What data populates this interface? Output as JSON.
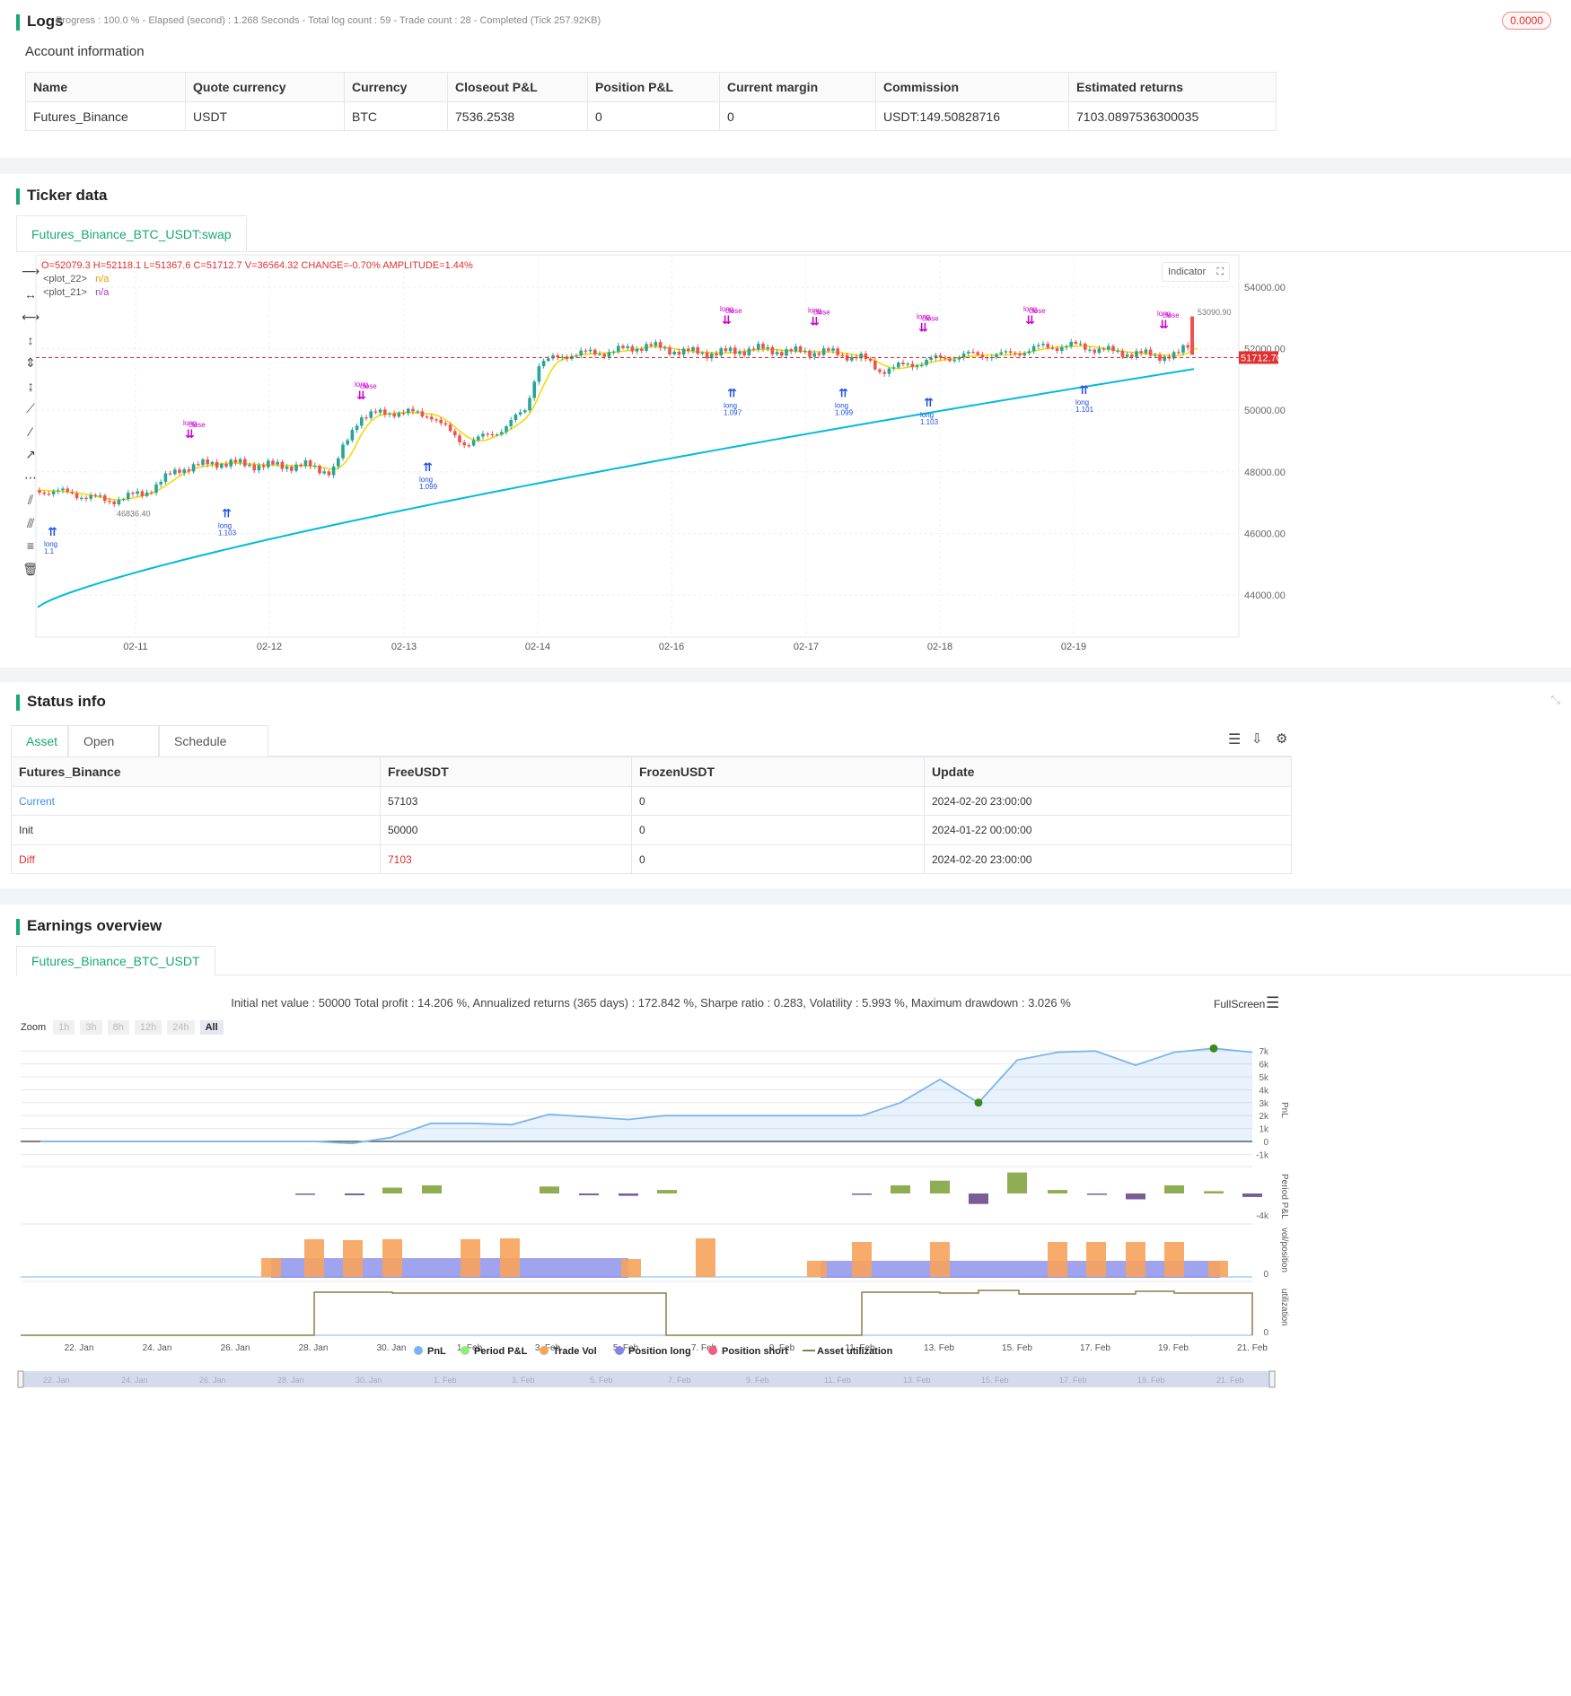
{
  "logs": {
    "title": "Logs",
    "summary": "Progress : 100.0 % - Elapsed (second) : 1.268  Seconds - Total log count : 59 - Trade count : 28 - Completed (Tick 257.92KB)",
    "badge": "0.0000"
  },
  "account": {
    "title": "Account information",
    "headers": [
      "Name",
      "Quote currency",
      "Currency",
      "Closeout P&L",
      "Position P&L",
      "Current margin",
      "Commission",
      "Estimated returns"
    ],
    "row": [
      "Futures_Binance",
      "USDT",
      "BTC",
      "7536.2538",
      "0",
      "0",
      "USDT:149.50828716",
      "7103.0897536300035"
    ]
  },
  "ticker": {
    "title": "Ticker data",
    "tab": "Futures_Binance_BTC_USDT:swap",
    "ohlc": "O=52079.3 H=52118.1 L=51367.6 C=51712.7 V=36564.32 CHANGE=-0.70% AMPLITUDE=1.44%",
    "plot22": "<plot_22>",
    "plot21": "<plot_21>",
    "na": "n/a",
    "indicator_btn": "Indicator",
    "last_price": "51712.70",
    "high_label": "53090.90",
    "low_label": "46836.40",
    "y_ticks": [
      "54000.00",
      "52000.00",
      "50000.00",
      "48000.00",
      "46000.00",
      "44000.00"
    ],
    "x_ticks": [
      "02-11",
      "02-12",
      "02-13",
      "02-14",
      "02-16",
      "02-17",
      "02-18",
      "02-19"
    ],
    "colors": {
      "up": "#26a69a",
      "down": "#ef5350",
      "ma_fast": "#f5d90a",
      "ma_slow": "#00bcd4",
      "signal": "#cc00cc",
      "long": "#1e50e6"
    },
    "markers": {
      "long": "long",
      "close": "close"
    },
    "trade_labels": [
      "1.1",
      "1.103",
      "1.099",
      "1.097",
      "1.099",
      "1.103",
      "1.101"
    ]
  },
  "status": {
    "title": "Status info",
    "tabs": [
      "Asset",
      "Open orders",
      "Schedule orders"
    ],
    "headers": [
      "Futures_Binance",
      "FreeUSDT",
      "FrozenUSDT",
      "Update"
    ],
    "rows": [
      [
        "Current",
        "57103",
        "0",
        "2024-02-20 23:00:00"
      ],
      [
        "Init",
        "50000",
        "0",
        "2024-01-22 00:00:00"
      ],
      [
        "Diff",
        "7103",
        "0",
        "2024-02-20 23:00:00"
      ]
    ]
  },
  "earnings": {
    "title": "Earnings overview",
    "tab": "Futures_Binance_BTC_USDT",
    "summary": "Initial net value : 50000 Total profit : 14.206 %, Annualized returns (365 days) : 172.842 %, Sharpe ratio : 0.283, Volatility : 5.993 %, Maximum drawdown : 3.026 %",
    "fullscreen": "FullScreen",
    "zoom_label": "Zoom",
    "zoom_options": [
      "1h",
      "3h",
      "8h",
      "12h",
      "24h",
      "All"
    ],
    "pnl_ticks": [
      "7k",
      "6k",
      "5k",
      "4k",
      "3k",
      "2k",
      "1k",
      "0",
      "-1k"
    ],
    "period_tick": "-4k",
    "vol_tick": "0",
    "util_tick": "0",
    "axis_titles": [
      "PnL",
      "Period P&L",
      "vol/position",
      "utilization"
    ],
    "x_ticks": [
      "22. Jan",
      "24. Jan",
      "26. Jan",
      "28. Jan",
      "30. Jan",
      "1. Feb",
      "3. Feb",
      "5. Feb",
      "7. Feb",
      "9. Feb",
      "11. Feb",
      "13. Feb",
      "15. Feb",
      "17. Feb",
      "19. Feb",
      "21. Feb"
    ],
    "legend": [
      {
        "label": "PnL",
        "color": "#7cb5ec"
      },
      {
        "label": "Period P&L",
        "color": "#90ed7d"
      },
      {
        "label": "Trade Vol",
        "color": "#f7a35c"
      },
      {
        "label": "Position long",
        "color": "#8085e9"
      },
      {
        "label": "Position short",
        "color": "#f15c80"
      },
      {
        "label": "Asset utilization",
        "color": "#8d7d4a"
      }
    ]
  },
  "chart_data": [
    {
      "type": "line",
      "title": "",
      "xlabel": "",
      "ylabel": "PnL",
      "x": [
        "22. Jan",
        "24. Jan",
        "26. Jan",
        "28. Jan",
        "30. Jan",
        "31. Jan",
        "1. Feb",
        "2. Feb",
        "3. Feb",
        "4. Feb",
        "5. Feb",
        "6. Feb",
        "7. Feb",
        "8. Feb",
        "9. Feb",
        "10. Feb",
        "11. Feb",
        "12. Feb",
        "13. Feb",
        "14. Feb",
        "15. Feb",
        "16. Feb",
        "17. Feb",
        "18. Feb",
        "19. Feb",
        "20. Feb",
        "21. Feb"
      ],
      "series": [
        {
          "name": "PnL",
          "values": [
            0,
            0,
            0,
            0,
            -150,
            300,
            1400,
            1400,
            1300,
            2100,
            1900,
            1700,
            2000,
            2000,
            2000,
            2000,
            2000,
            3000,
            4800,
            3000,
            6300,
            6900,
            7000,
            5900,
            6900,
            7200,
            6900
          ]
        }
      ],
      "ylim": [
        -1000,
        7000
      ]
    },
    {
      "type": "bar",
      "title": "",
      "ylabel": "Period P&L",
      "series": [
        {
          "name": "Period P&L",
          "values": [
            0,
            0,
            0,
            0,
            -100,
            0,
            400,
            700,
            0,
            500,
            -100,
            -150,
            200,
            0,
            0,
            0,
            0,
            -100,
            700,
            1100,
            -1100,
            1800,
            300,
            -100,
            -500,
            700,
            200,
            -300
          ]
        }
      ]
    }
  ]
}
